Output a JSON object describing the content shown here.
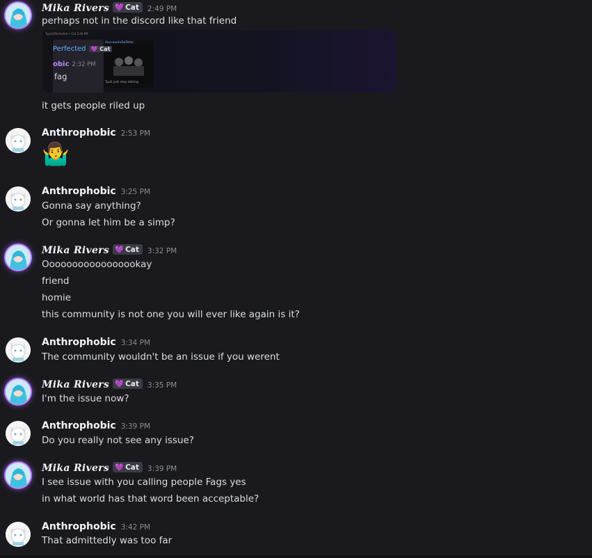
{
  "messages": [
    {
      "author": "Mika Rivers",
      "badge": "Cat",
      "time": "2:49 PM",
      "lines": [
        "perhaps not in the discord like that friend"
      ],
      "embed": {
        "top_text": "Type(i)Perfected • Cat  2:49 PM",
        "line1": "Perfected",
        "line1_badge": "Cat",
        "line2": "obic",
        "line2_time": "2:32 PM",
        "line3": "fag",
        "right_name": "RaccoonInDaTeller",
        "right_caption": "TypE just stop talking"
      },
      "after": "it gets people riled up"
    },
    {
      "author": "Anthrophobic",
      "time": "2:53 PM",
      "emoji": "🤷‍♂️"
    },
    {
      "author": "Anthrophobic",
      "time": "3:25 PM",
      "lines": [
        "Gonna say anything?",
        "Or gonna let him be a simp?"
      ]
    },
    {
      "author": "Mika Rivers",
      "badge": "Cat",
      "time": "3:32 PM",
      "lines": [
        "Ooooooooooooooookay",
        "friend",
        "homie",
        "this community is not one you will ever like again is it?"
      ]
    },
    {
      "author": "Anthrophobic",
      "time": "3:34 PM",
      "lines": [
        "The community wouldn't be an issue if you werent"
      ]
    },
    {
      "author": "Mika Rivers",
      "badge": "Cat",
      "time": "3:35 PM",
      "lines": [
        "I'm the issue now?"
      ]
    },
    {
      "author": "Anthrophobic",
      "time": "3:39 PM",
      "lines": [
        "Do you really not see any issue?"
      ]
    },
    {
      "author": "Mika Rivers",
      "badge": "Cat",
      "time": "3:39 PM",
      "lines": [
        "I see issue with you calling people Fags yes",
        "in what world has that word been acceptable?"
      ]
    },
    {
      "author": "Anthrophobic",
      "time": "3:42 PM",
      "lines": [
        "That admittedly was too far"
      ]
    }
  ],
  "colors": {
    "background": "#1a1a1e",
    "text": "#dbdee1",
    "timestamp": "#8a8d93",
    "badge_heart": "#b48cff"
  }
}
